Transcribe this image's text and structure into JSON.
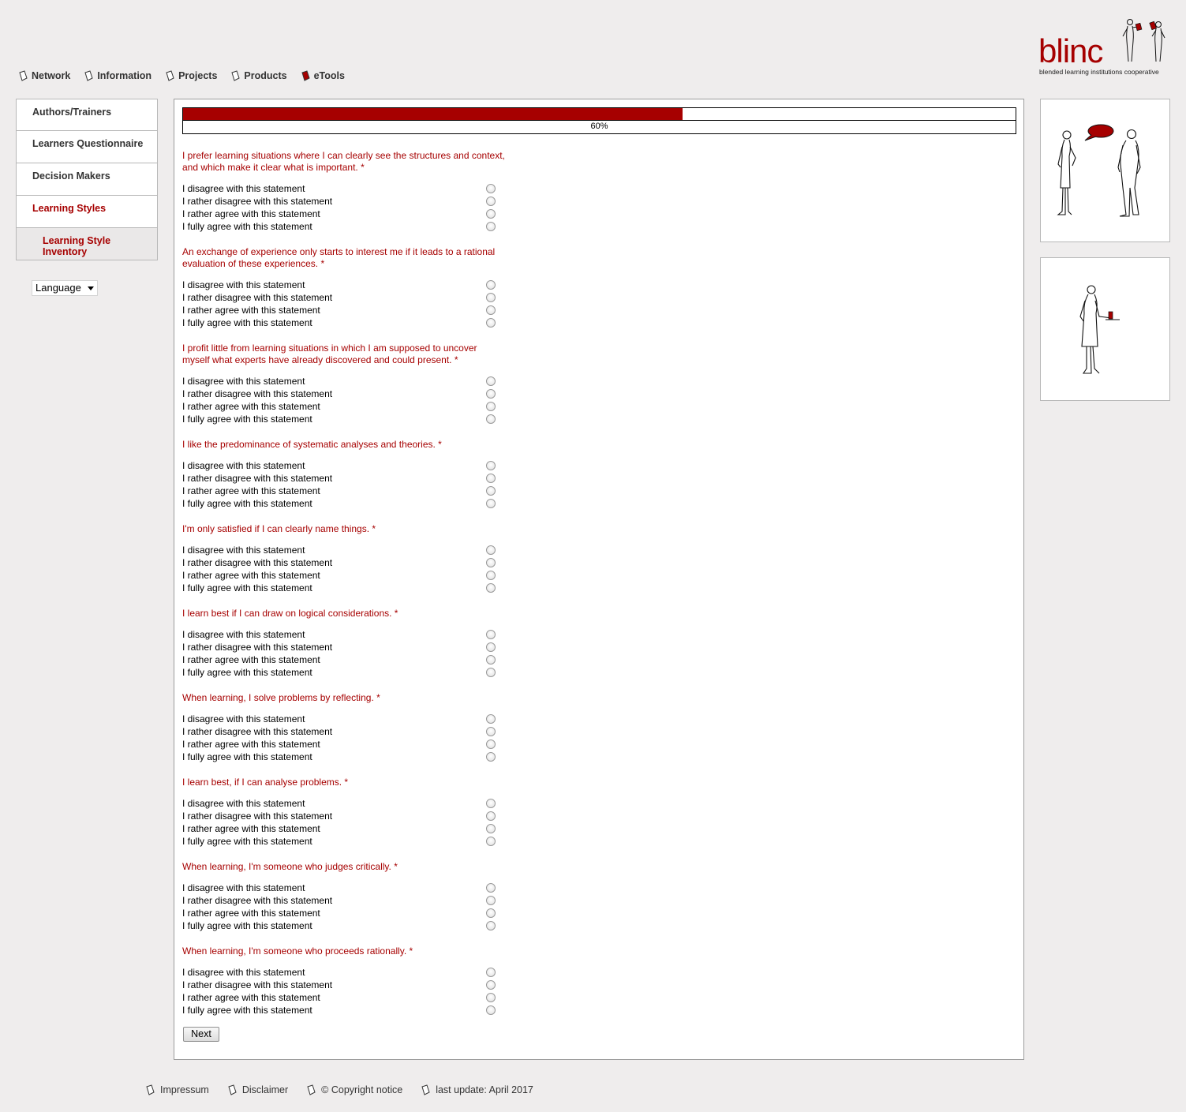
{
  "nav": {
    "items": [
      {
        "label": "Network",
        "icon": "page-icon"
      },
      {
        "label": "Information",
        "icon": "page-icon"
      },
      {
        "label": "Projects",
        "icon": "page-icon"
      },
      {
        "label": "Products",
        "icon": "page-icon"
      },
      {
        "label": "eTools",
        "icon": "red-page-icon"
      }
    ]
  },
  "logo": {
    "word": "blinc",
    "tagline": "blended learning institutions cooperative"
  },
  "sidebar": {
    "items": [
      {
        "label": "Authors/Trainers"
      },
      {
        "label": "Learners Questionnaire"
      },
      {
        "label": "Decision Makers"
      },
      {
        "label": "Learning Styles"
      },
      {
        "label": "Learning Style Inventory"
      }
    ],
    "language_label": "Language"
  },
  "progress": {
    "percent": 60,
    "label": "60%",
    "fill_color": "#a60000"
  },
  "options": [
    "I disagree with this statement",
    "I rather disagree with this statement",
    "I rather agree with this statement",
    "I fully agree with this statement"
  ],
  "questions": [
    {
      "text": "I prefer learning situations where I can clearly see the structures and context, and which make it clear what is important. *"
    },
    {
      "text": "An exchange of experience only starts to interest me if it leads to a rational evaluation of these experiences. *"
    },
    {
      "text": "I profit little from learning situations in which I am supposed to uncover myself what experts have already discovered and could present. *"
    },
    {
      "text": "I like the predominance of systematic analyses and theories. *"
    },
    {
      "text": "I'm only satisfied if I can clearly name things. *"
    },
    {
      "text": "I learn best if I can draw on logical considerations. *"
    },
    {
      "text": "When learning, I solve problems by reflecting. *"
    },
    {
      "text": "I learn best, if I can analyse problems. *"
    },
    {
      "text": "When learning, I'm someone who judges critically. *"
    },
    {
      "text": "When learning, I'm someone who proceeds rationally. *"
    }
  ],
  "next_label": "Next",
  "footer": {
    "items": [
      {
        "label": "Impressum"
      },
      {
        "label": "Disclaimer"
      },
      {
        "label": "© Copyright notice"
      },
      {
        "label": "last update: April 2017"
      }
    ]
  },
  "colors": {
    "brand": "#a60000",
    "background": "#efeded"
  }
}
